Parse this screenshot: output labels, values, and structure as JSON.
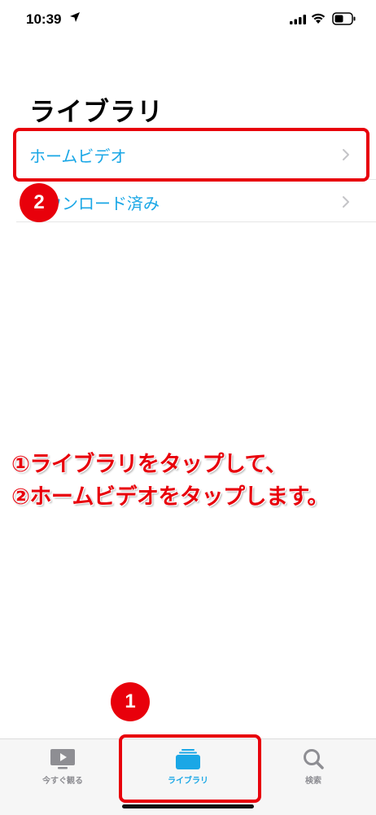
{
  "status_bar": {
    "time": "10:39"
  },
  "page": {
    "title": "ライブラリ"
  },
  "list": {
    "items": [
      {
        "label": "ホームビデオ"
      },
      {
        "label": "ダウンロード済み"
      }
    ]
  },
  "annotations": {
    "badges": [
      "1",
      "2"
    ],
    "instructions": [
      "①ライブラリをタップして、",
      "②ホームビデオをタップします。"
    ],
    "highlight_color": "#e8000b"
  },
  "tab_bar": {
    "tabs": [
      {
        "label": "今すぐ観る",
        "icon": "tv-play-icon"
      },
      {
        "label": "ライブラリ",
        "icon": "library-stack-icon",
        "selected": true
      },
      {
        "label": "検索",
        "icon": "search-icon"
      }
    ]
  },
  "colors": {
    "accent": "#1aa7e6",
    "annotation": "#e8000b"
  }
}
